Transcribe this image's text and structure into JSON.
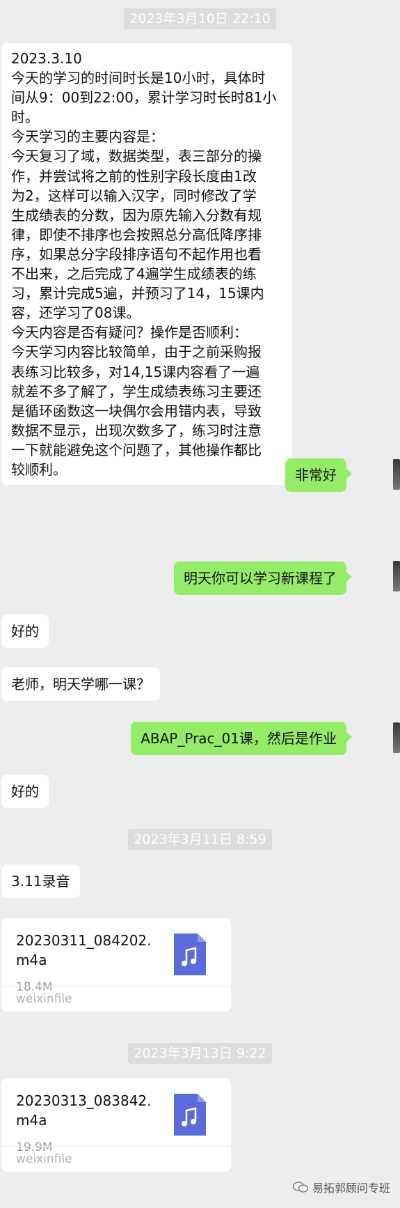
{
  "timestamps": [
    "2023年3月10日 22:10",
    "2023年3月11日 8:59",
    "2023年3月13日 9:22"
  ],
  "long_message": {
    "lines": [
      "2023.3.10",
      "今天的学习的时间时长是10小时，具体时",
      "间从9：00到22:00，累计学习时长时81小",
      "时。",
      "今天学习的主要内容是：",
      "今天复习了域，数据类型，表三部分的操",
      "作，并尝试将之前的性别字段长度由1改",
      "为2，这样可以输入汉字，同时修改了学",
      "生成绩表的分数，因为原先输入分数有规",
      "律，即使不排序也会按照总分高低降序排",
      "序，如果总分字段排序语句不起作用也看",
      "不出来，之后完成了4遍学生成绩表的练",
      "习，累计完成5遍，并预习了14，15课内",
      "容，还学习了08课。",
      "今天内容是否有疑问？操作是否顺利：",
      "今天学习内容比较简单，由于之前采购报",
      "表练习比较多，对14,15课内容看了一遍",
      "就差不多了解了，学生成绩表练习主要还",
      "是循环函数这一块偶尔会用错内表，导致",
      "数据不显示，出现次数多了，练习时注意",
      "一下就能避免这个问题了，其他操作都比",
      "较顺利。"
    ]
  },
  "messages": {
    "m1": "非常好",
    "m2": "明天你可以学习新课程了",
    "m3": "好的",
    "m4": "老师，明天学哪一课？",
    "m5": "ABAP_Prac_01课，然后是作业",
    "m6": "好的",
    "m7": "3.11录音"
  },
  "files": [
    {
      "name": "20230311_084202.m4a",
      "size": "18.4M",
      "source": "weixinfile",
      "icon": "music-file-icon"
    },
    {
      "name": "20230313_083842.m4a",
      "size": "19.9M",
      "source": "weixinfile",
      "icon": "music-file-icon"
    }
  ],
  "watermark": "易拓郭顾问专班",
  "colors": {
    "bubble_mine": "#95ec69",
    "bubble_other": "#ffffff",
    "background": "#ededed",
    "file_icon": "#5b6bd9"
  }
}
